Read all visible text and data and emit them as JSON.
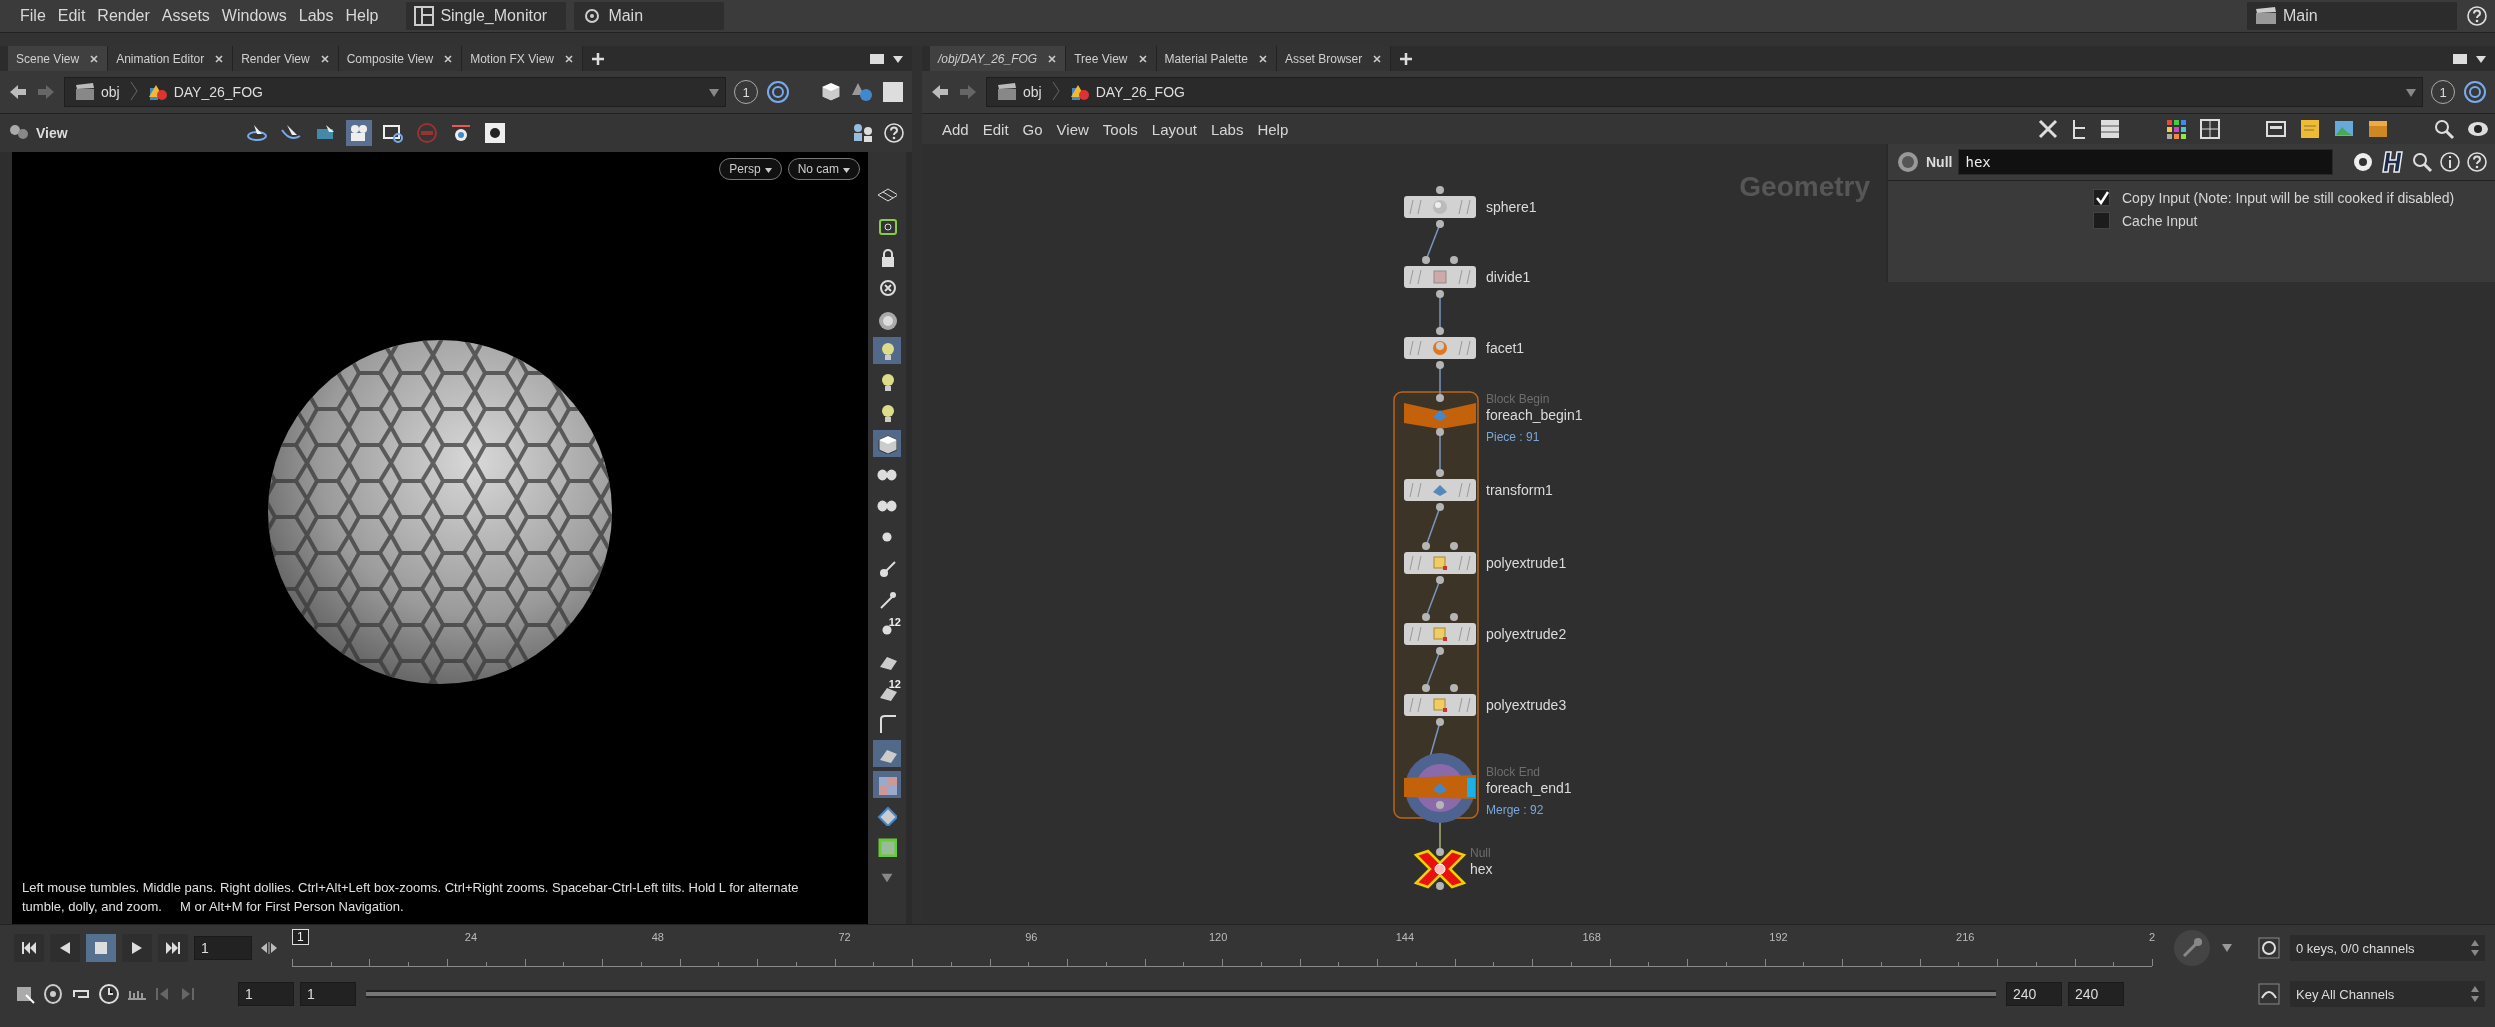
{
  "menu_bar": {
    "items": [
      "File",
      "Edit",
      "Render",
      "Assets",
      "Windows",
      "Labs",
      "Help"
    ],
    "desktop": "Single_Monitor",
    "context": "Main",
    "right_context": "Main"
  },
  "scene_pane": {
    "tabs": [
      {
        "label": "Scene View",
        "selected": true
      },
      {
        "label": "Animation Editor",
        "selected": false
      },
      {
        "label": "Render View",
        "selected": false
      },
      {
        "label": "Composite View",
        "selected": false
      },
      {
        "label": "Motion FX View",
        "selected": false
      }
    ],
    "path": [
      "obj",
      "DAY_26_FOG"
    ],
    "viewer_number": "1",
    "view_title": "View",
    "view_tools": [
      {
        "selected": false
      },
      {
        "selected": false
      },
      {
        "selected": false
      },
      {
        "selected": true
      },
      {
        "selected": false
      },
      {
        "selected": false
      },
      {
        "selected": false
      },
      {
        "selected": false
      }
    ],
    "camera_menus": [
      "Persp",
      "No cam"
    ],
    "help_text": "Left mouse tumbles. Middle pans. Right dollies. Ctrl+Alt+Left box-zooms. Ctrl+Right zooms. Spacebar-Ctrl-Left tilts. Hold L for alternate tumble, dolly, and zoom.     M or Alt+M for First Person Navigation.",
    "side_tools": [
      {
        "selected": false
      },
      {
        "selected": false
      },
      {
        "selected": false
      },
      {
        "selected": false
      },
      {
        "selected": false
      },
      {
        "selected": true
      },
      {
        "selected": false
      },
      {
        "selected": false
      },
      {
        "selected": true
      },
      {
        "selected": false
      },
      {
        "selected": false
      },
      {
        "selected": false
      },
      {
        "selected": false
      },
      {
        "selected": false
      },
      {
        "selected": false,
        "badge": "12"
      },
      {
        "selected": false
      },
      {
        "selected": false,
        "badge": "12"
      },
      {
        "selected": false
      },
      {
        "selected": true
      },
      {
        "selected": true
      },
      {
        "selected": false
      },
      {
        "selected": false
      },
      {
        "selected": false
      }
    ]
  },
  "network_pane": {
    "tabs": [
      {
        "label": "/obj/DAY_26_FOG",
        "selected": true
      },
      {
        "label": "Tree View",
        "selected": false
      },
      {
        "label": "Material Palette",
        "selected": false
      },
      {
        "label": "Asset Browser",
        "selected": false
      }
    ],
    "path": [
      "obj",
      "DAY_26_FOG"
    ],
    "viewer_number": "1",
    "menu": [
      "Add",
      "Edit",
      "Go",
      "View",
      "Tools",
      "Layout",
      "Labs",
      "Help"
    ],
    "context_label": "Geometry",
    "nodes": [
      {
        "name": "sphere1",
        "kind": "sop",
        "multi_input": false
      },
      {
        "name": "divide1",
        "kind": "sop",
        "multi_input": true
      },
      {
        "name": "facet1",
        "kind": "sop",
        "multi_input": false
      },
      {
        "name": "foreach_begin1",
        "kind": "block_begin",
        "header": "Block Begin",
        "info": "Piece : 91",
        "multi_input": false
      },
      {
        "name": "transform1",
        "kind": "sop",
        "multi_input": false
      },
      {
        "name": "polyextrude1",
        "kind": "sop",
        "multi_input": true
      },
      {
        "name": "polyextrude2",
        "kind": "sop",
        "multi_input": true
      },
      {
        "name": "polyextrude3",
        "kind": "sop",
        "multi_input": true
      },
      {
        "name": "foreach_end1",
        "kind": "block_end",
        "header": "Block End",
        "info": "Merge : 92",
        "multi_input": true
      },
      {
        "name": "hex",
        "kind": "null",
        "header": "Null",
        "multi_input": false
      }
    ],
    "parameters": {
      "type": "Null",
      "name": "hex",
      "options": [
        {
          "label": "Copy Input (Note: Input will be still cooked if disabled)",
          "checked": true
        },
        {
          "label": "Cache Input",
          "checked": false
        }
      ]
    }
  },
  "timeline": {
    "frame": "1",
    "current_marker": "1",
    "ticks": [
      "24",
      "48",
      "72",
      "96",
      "120",
      "144",
      "168",
      "192",
      "216",
      "2"
    ],
    "start": "1",
    "range_start": "1",
    "range_end": "240",
    "end": "240",
    "range": {
      "level": 1
    },
    "keys_status": "0 keys, 0/0 channels",
    "key_menu": "Key All Channels"
  }
}
